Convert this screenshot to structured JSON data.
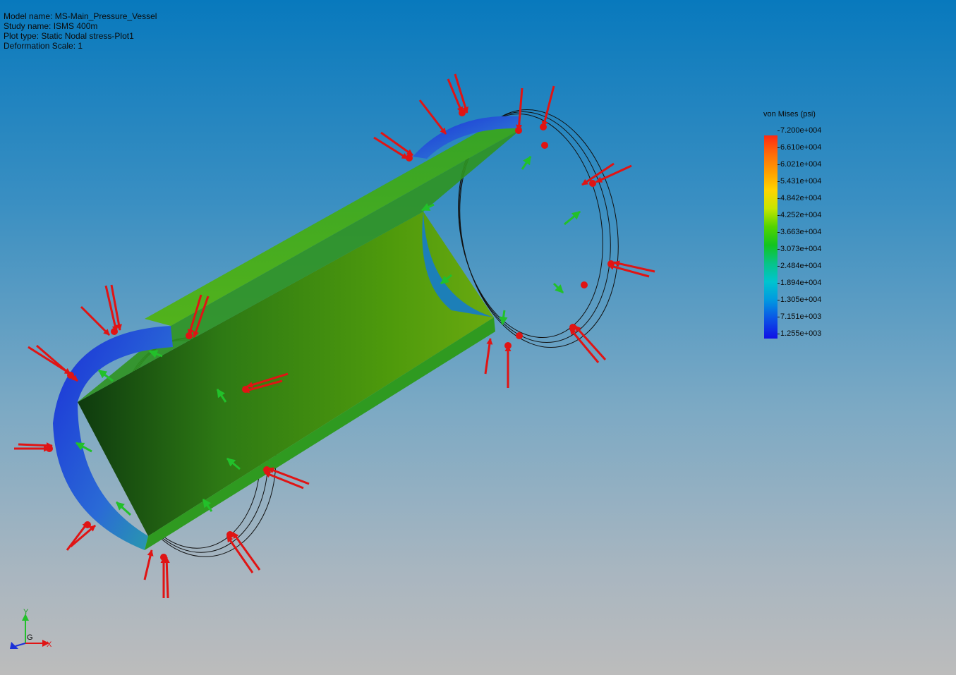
{
  "info": {
    "model_name": "Model name: MS-Main_Pressure_Vessel",
    "study_name": "Study name: ISMS 400m",
    "plot_type": "Plot type: Static Nodal stress-Plot1",
    "deformation_scale": "Deformation Scale: 1"
  },
  "legend": {
    "title": "von Mises (psi)",
    "ticks": [
      "7.200e+004",
      "6.610e+004",
      "6.021e+004",
      "5.431e+004",
      "4.842e+004",
      "4.252e+004",
      "3.663e+004",
      "3.073e+004",
      "2.484e+004",
      "1.894e+004",
      "1.305e+004",
      "7.151e+003",
      "1.255e+003"
    ]
  },
  "triad": {
    "x_label": "X",
    "y_label": "Y",
    "origin_label": "G"
  },
  "colors": {
    "background_top": "#0879bd",
    "background_bottom": "#bcbcbc",
    "load_arrow": "#e01414",
    "fixture_arrow": "#22c02a",
    "body_green": "#3f9f24",
    "edge_blue": "#1a30d8"
  }
}
